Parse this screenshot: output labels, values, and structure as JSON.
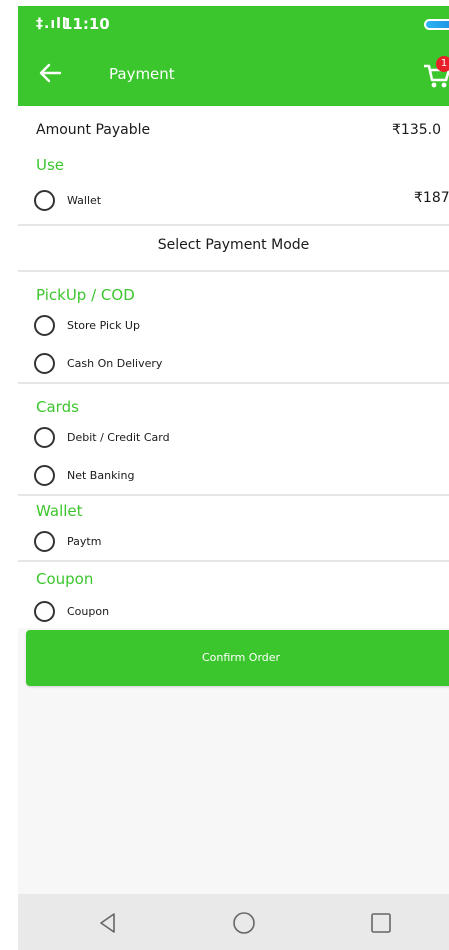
{
  "status_bar": {
    "signal": "‡.ıll",
    "time": "11:10"
  },
  "app_bar": {
    "title": "Payment",
    "cart_badge": "1"
  },
  "summary": {
    "amount_label": "Amount Payable",
    "amount_value": "₹135.0",
    "use_heading": "Use",
    "wallet_label": "Wallet",
    "wallet_value": "₹187"
  },
  "select_mode_title": "Select Payment Mode",
  "sections": {
    "pickup": {
      "heading": "PickUp / COD",
      "options": [
        "Store Pick Up",
        "Cash On Delivery"
      ]
    },
    "cards": {
      "heading": "Cards",
      "options": [
        "Debit / Credit Card",
        "Net Banking"
      ]
    },
    "wallet": {
      "heading": "Wallet",
      "options": [
        "Paytm"
      ]
    },
    "coupon": {
      "heading": "Coupon",
      "options": [
        "Coupon"
      ]
    }
  },
  "confirm_label": "Confirm Order",
  "colors": {
    "brand_green": "#3cc62d",
    "badge_red": "#e8202a"
  },
  "icons": {
    "back": "arrow-left-icon",
    "cart": "cart-icon",
    "nav_back": "triangle-back-icon",
    "nav_home": "circle-home-icon",
    "nav_recent": "square-recent-icon"
  }
}
